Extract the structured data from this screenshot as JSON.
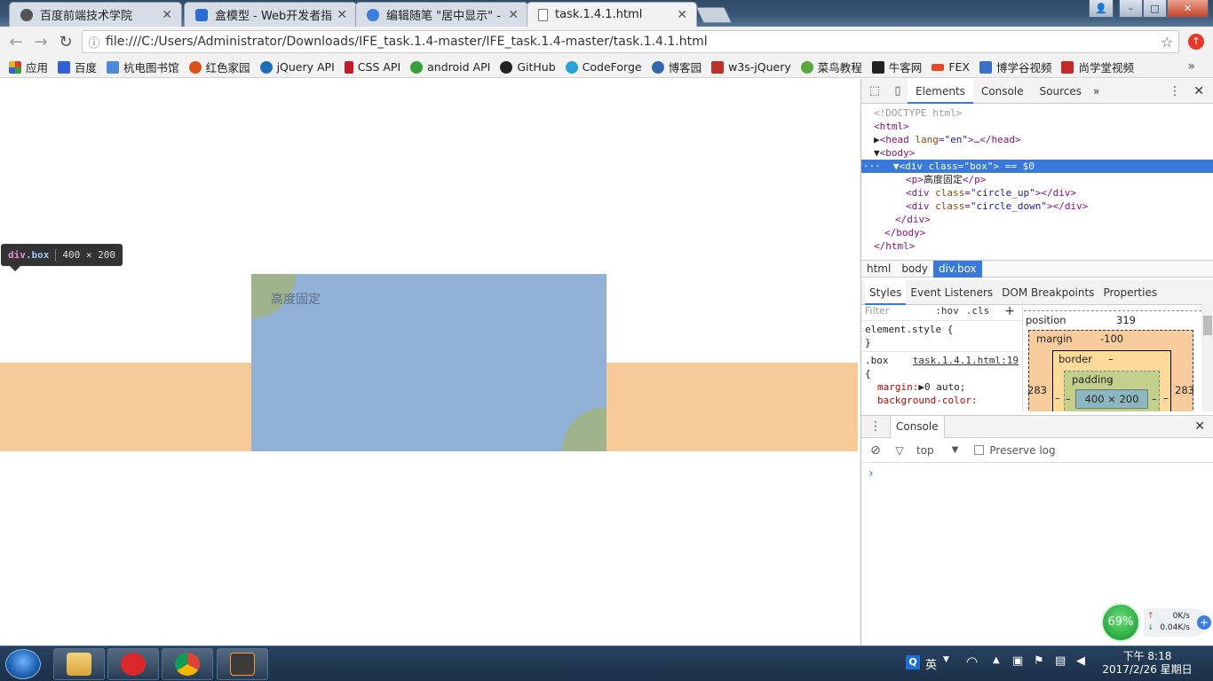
{
  "browser": {
    "tabs": [
      {
        "title": "百度前端技术学院",
        "icon_color": "#555555"
      },
      {
        "title": "盒模型 - Web开发者指南",
        "icon_color": "#2a6fcf"
      },
      {
        "title": "编辑随笔 \"居中显示\" - 博",
        "icon_color": "#3a7fe0"
      },
      {
        "title": "task.1.4.1.html",
        "icon_color": "#777777"
      }
    ],
    "window_buttons": {
      "minimize": "–",
      "maximize": "□",
      "close": "✕",
      "user": "👤"
    },
    "url": "file:///C:/Users/Administrator/Downloads/IFE_task.1.4-master/IFE_task.1.4-master/task.1.4.1.html",
    "ext_badge": "↑"
  },
  "bookmarks": [
    {
      "label": "应用",
      "color": "#d4402c"
    },
    {
      "label": "百度",
      "color": "#3360d8"
    },
    {
      "label": "杭电图书馆",
      "color": "#4f8ad8"
    },
    {
      "label": "红色家园",
      "color": "#d9531e"
    },
    {
      "label": "jQuery API",
      "color": "#1f6fb8"
    },
    {
      "label": "CSS API",
      "color": "#c41a2a"
    },
    {
      "label": "android API",
      "color": "#3a9e3a"
    },
    {
      "label": "GitHub",
      "color": "#222222"
    },
    {
      "label": "CodeForge",
      "color": "#2aa2d4"
    },
    {
      "label": "博客园",
      "color": "#3366aa"
    },
    {
      "label": "w3s-jQuery",
      "color": "#c0302a"
    },
    {
      "label": "菜鸟教程",
      "color": "#5aa640"
    },
    {
      "label": "牛客网",
      "color": "#222222"
    },
    {
      "label": "FEX",
      "color": "#e34a2a"
    },
    {
      "label": "博学谷视频",
      "color": "#3a70c8"
    },
    {
      "label": "尚学堂视频",
      "color": "#c42a2a"
    }
  ],
  "bookmarks_more": "»",
  "page": {
    "box_text": "高度固定",
    "tooltip": {
      "tag": "div",
      "cls": ".box",
      "size": "400 × 200"
    },
    "colors": {
      "band": "#f7cb98",
      "box": "#91b2d6",
      "circles": "#9fb38d"
    }
  },
  "devtools": {
    "tabs": [
      "Elements",
      "Console",
      "Sources"
    ],
    "more": "»",
    "dom": {
      "doctype": "<!DOCTYPE html>",
      "html_open": "<html>",
      "head_tag": "<head",
      "head_attr": "lang",
      "head_val": "\"en\"",
      "head_rest": ">…</head>",
      "body_open": "<body>",
      "div_tag": "<div",
      "div_attr": "class",
      "div_val": "\"box\"",
      "div_end": "> == $0",
      "p_open": "<p>",
      "p_text": "高度固定",
      "p_close": "</p>",
      "c1_tag": "<div",
      "c1_attr": "class",
      "c1_val": "\"circle_up\"",
      "c1_end": "></div>",
      "c2_tag": "<div",
      "c2_attr": "class",
      "c2_val": "\"circle_down\"",
      "c2_end": "></div>",
      "div_close": "</div>",
      "body_close": "</body>",
      "html_close": "</html>"
    },
    "breadcrumbs": [
      "html",
      "body",
      "div.box"
    ],
    "style_tabs": [
      "Styles",
      "Event Listeners",
      "DOM Breakpoints",
      "Properties"
    ],
    "filter_placeholder": "Filter",
    "hov": ":hov",
    "cls": ".cls",
    "add": "+",
    "element_style": "element.style {",
    "close_brace": "}",
    "rule_selector": ".box",
    "rule_link": "task.1.4.1.html:19",
    "open_brace": "{",
    "prop_margin": "margin:",
    "val_margin": "▶0 auto;",
    "prop_bg": "background-color:",
    "boxmodel": {
      "position_label": "position",
      "position_val": "319",
      "margin_label": "margin",
      "margin_val": "-100",
      "border_label": "border",
      "border_val": "–",
      "padding_label": "padding",
      "padding_val": "-",
      "content": "400 × 200",
      "left": "283",
      "right": "283",
      "dash": "–"
    },
    "console": {
      "title": "Console",
      "context": "top",
      "preserve": "Preserve log",
      "prompt": "›"
    }
  },
  "net_widget": {
    "percent": "69%",
    "up": "0K/s",
    "down": "0.04K/s"
  },
  "taskbar": {
    "ime": "英",
    "time": "下午 8:18",
    "date": "2017/2/26 星期日"
  }
}
